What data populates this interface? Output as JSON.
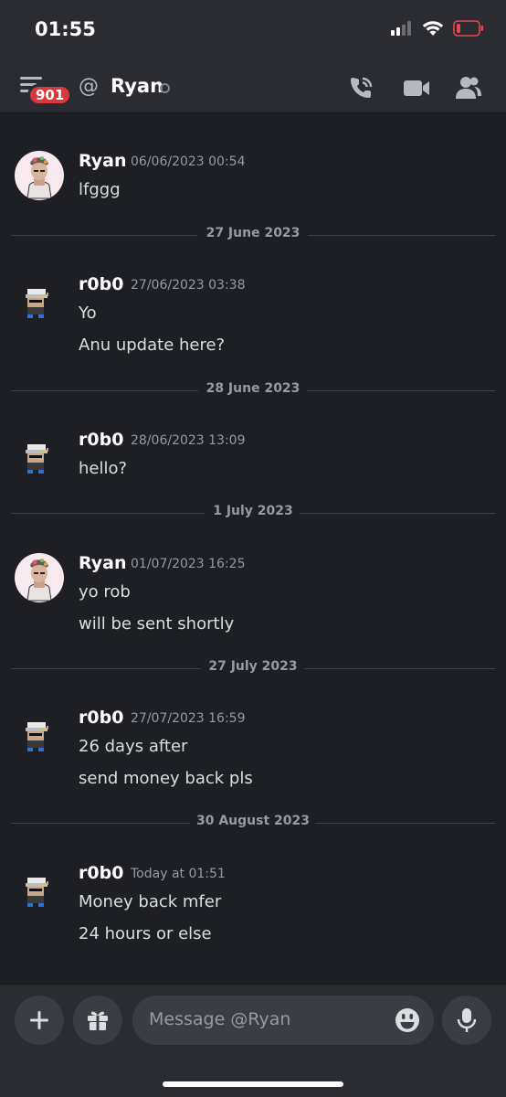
{
  "status_bar": {
    "time": "01:55"
  },
  "header": {
    "badge": "901",
    "at": "@",
    "title": "Ryan"
  },
  "messages": [
    {
      "author": "Ryan",
      "timestamp": "06/06/2023 00:54",
      "lines": [
        "lfggg"
      ]
    },
    {
      "author": "r0b0",
      "timestamp": "27/06/2023 03:38",
      "lines": [
        "Yo",
        "Anu update here?"
      ]
    },
    {
      "author": "r0b0",
      "timestamp": "28/06/2023 13:09",
      "lines": [
        "hello?"
      ]
    },
    {
      "author": "Ryan",
      "timestamp": "01/07/2023 16:25",
      "lines": [
        "yo rob",
        "will be sent shortly"
      ]
    },
    {
      "author": "r0b0",
      "timestamp": "27/07/2023 16:59",
      "lines": [
        "26 days after",
        "send money back pls"
      ]
    },
    {
      "author": "r0b0",
      "timestamp": "Today at 01:51",
      "lines": [
        "Money back mfer",
        "24 hours or else"
      ]
    }
  ],
  "dividers": [
    "27 June 2023",
    "28 June 2023",
    "1 July 2023",
    "27 July 2023",
    "30 August 2023"
  ],
  "composer": {
    "placeholder": "Message @Ryan"
  },
  "colors": {
    "background": "#1e1f24",
    "bar": "#2b2c32",
    "badge": "#da373c",
    "battery_low": "#e5484d"
  }
}
